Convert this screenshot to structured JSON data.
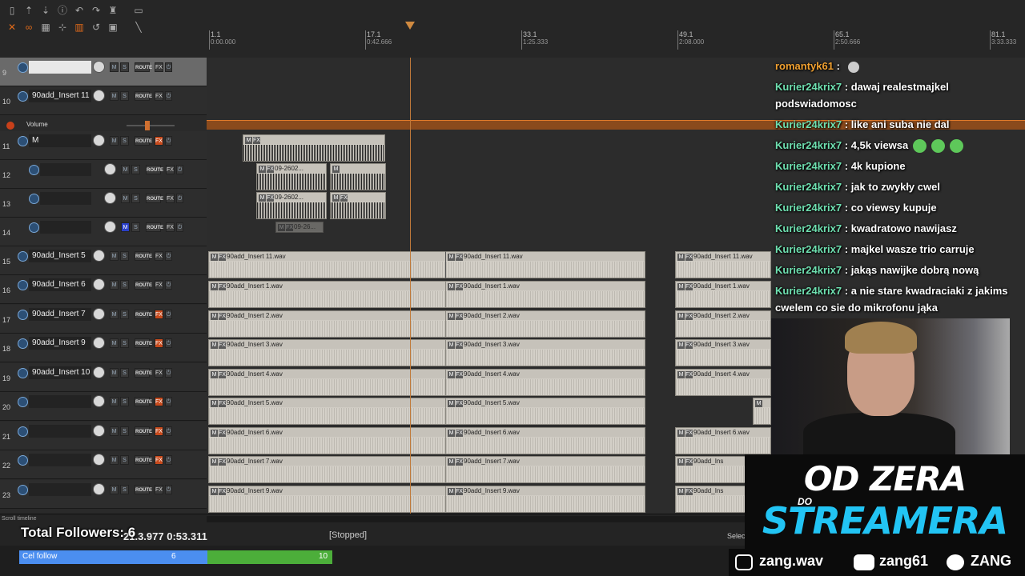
{
  "ruler": {
    "markers": [
      {
        "label": "1.1",
        "time": "0:00.000"
      },
      {
        "label": "17.1",
        "time": "0:42.666"
      },
      {
        "label": "33.1",
        "time": "1:25.333"
      },
      {
        "label": "49.1",
        "time": "2:08.000"
      },
      {
        "label": "65.1",
        "time": "2:50.666"
      },
      {
        "label": "81.1",
        "time": "3:33.333"
      }
    ]
  },
  "tracks": [
    {
      "num": "9",
      "name": "",
      "fx_on": false
    },
    {
      "num": "10",
      "name": "90add_Insert 11",
      "fx_on": false
    },
    {
      "num": "11",
      "name": "M",
      "fx_on": true
    },
    {
      "num": "12",
      "name": "",
      "fx_on": false
    },
    {
      "num": "13",
      "name": "",
      "fx_on": false
    },
    {
      "num": "14",
      "name": "",
      "fx_on": false
    },
    {
      "num": "15",
      "name": "90add_Insert 5",
      "fx_on": false
    },
    {
      "num": "16",
      "name": "90add_Insert 6",
      "fx_on": false
    },
    {
      "num": "17",
      "name": "90add_Insert 7",
      "fx_on": true
    },
    {
      "num": "18",
      "name": "90add_Insert 9",
      "fx_on": true
    },
    {
      "num": "19",
      "name": "90add_Insert 10",
      "fx_on": false
    },
    {
      "num": "20",
      "name": "",
      "fx_on": true
    },
    {
      "num": "21",
      "name": "",
      "fx_on": true
    },
    {
      "num": "22",
      "name": "",
      "fx_on": true
    },
    {
      "num": "23",
      "name": "",
      "fx_on": false
    }
  ],
  "volume_label": "Volume",
  "button_labels": {
    "m": "M",
    "s": "S",
    "route": "ROUTE",
    "fx": "FX",
    "pwr": "⏻"
  },
  "item_labels": {
    "row15": "90add_Insert 11.wav",
    "row16": "90add_Insert 1.wav",
    "row17": "90add_Insert 2.wav",
    "row18": "90add_Insert 3.wav",
    "row19": "90add_Insert 4.wav",
    "row20": "90add_Insert 5.wav",
    "row21": "90add_Insert 6.wav",
    "row22": "90add_Insert 7.wav",
    "row23": "90add_Insert 9.wav",
    "row22_short": "90add_Ins",
    "clip_a": "09-2602...",
    "clip_b": "09-2602...",
    "clip_c": "09-26..."
  },
  "transport": {
    "status": "[Stopped]",
    "time": "21.3.97",
    "time2": "7 0:53.311",
    "scroll_label": "Scroll timeline",
    "select_label": "Select"
  },
  "followers": {
    "text": "Total Followers: 6",
    "goal_label": "Cel follow",
    "current": "6",
    "target": "10",
    "progress": 0.6
  },
  "chat": [
    {
      "user": "romantyk61",
      "text": "",
      "emote": true,
      "orange": true
    },
    {
      "user": "Kurier24krix7",
      "text": "dawaj realestmajkel",
      "text2": "podswiadomosc"
    },
    {
      "user": "Kurier24krix7",
      "text": "like ani suba nie dal"
    },
    {
      "user": "Kurier24krix7",
      "text": "4,5k viewsa",
      "emotes": 3
    },
    {
      "user": "Kurier24krix7",
      "text": "4k kupione"
    },
    {
      "user": "Kurier24krix7",
      "text": "jak to zwykły cwel"
    },
    {
      "user": "Kurier24krix7",
      "text": "co viewsy kupuje"
    },
    {
      "user": "Kurier24krix7",
      "text": "kwadratowo nawijasz"
    },
    {
      "user": "Kurier24krix7",
      "text": "majkel wasze trio carruje"
    },
    {
      "user": "Kurier24krix7",
      "text": "jakąs nawijke dobrą nową"
    },
    {
      "user": "Kurier24krix7",
      "text": "a nie stare kwadraciaki z jakims",
      "text2": "cwelem co sie do mikrofonu jąka"
    }
  ],
  "logo": {
    "line1": "OD ZERA",
    "line2": "DO",
    "line3": "STREAMERA"
  },
  "socials": {
    "instagram": "zang.wav",
    "youtube": "zang61",
    "spotify": "ZANG"
  },
  "colors": {
    "accent_orange": "#e06a1a",
    "chat_user": "#6ee0b0",
    "logo_cyan": "#22c4f4",
    "goal_blue": "#4b8ef0",
    "goal_green": "#4cae3a"
  }
}
